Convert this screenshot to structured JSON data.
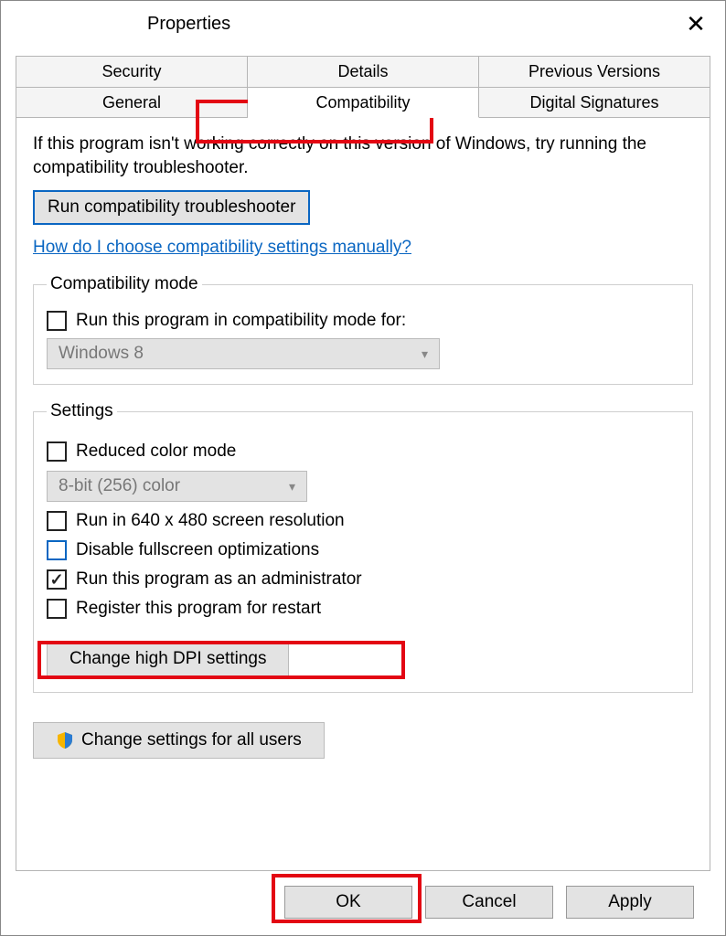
{
  "title": "Properties",
  "tabs": {
    "row1": [
      "Security",
      "Details",
      "Previous Versions"
    ],
    "row2": [
      "General",
      "Compatibility",
      "Digital Signatures"
    ],
    "active": "Compatibility"
  },
  "intro": "If this program isn't working correctly on this version of Windows, try running the compatibility troubleshooter.",
  "troubleshoot_btn": "Run compatibility troubleshooter",
  "manual_link": "How do I choose compatibility settings manually?",
  "compat_mode": {
    "legend": "Compatibility mode",
    "checkbox_label": "Run this program in compatibility mode for:",
    "checked": false,
    "combo_value": "Windows 8"
  },
  "settings": {
    "legend": "Settings",
    "reduced_color": {
      "label": "Reduced color mode",
      "checked": false,
      "combo_value": "8-bit (256) color"
    },
    "low_res": {
      "label": "Run in 640 x 480 screen resolution",
      "checked": false
    },
    "disable_fullscreen": {
      "label": "Disable fullscreen optimizations",
      "checked": false
    },
    "run_admin": {
      "label": "Run this program as an administrator",
      "checked": true
    },
    "register_restart": {
      "label": "Register this program for restart",
      "checked": false
    },
    "dpi_btn": "Change high DPI settings"
  },
  "all_users_btn": "Change settings for all users",
  "buttons": {
    "ok": "OK",
    "cancel": "Cancel",
    "apply": "Apply"
  }
}
